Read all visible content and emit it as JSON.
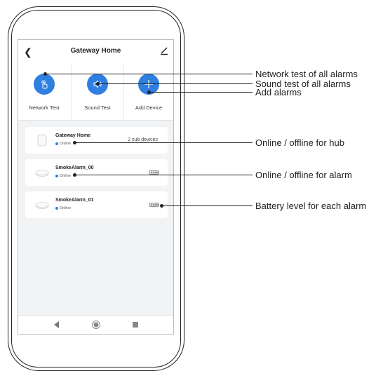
{
  "screen": {
    "title": "Gateway Home",
    "actions": [
      {
        "label": "Network Test",
        "icon": "hand-tap-icon"
      },
      {
        "label": "Sound Test",
        "icon": "speaker-icon"
      },
      {
        "label": "Add Device",
        "icon": "plus-icon"
      }
    ],
    "devices": [
      {
        "name": "Gateway Home",
        "status": "Online",
        "detail": "2 sub devices",
        "icon": "hub-icon"
      },
      {
        "name": "SmokeAlarm_00",
        "status": "Online",
        "icon": "smoke-alarm-icon"
      },
      {
        "name": "SmokeAlarm_01",
        "status": "Online",
        "icon": "smoke-alarm-icon"
      }
    ]
  },
  "callouts": [
    "Network test of all alarms",
    "Sound test of all alarms",
    "Add alarms",
    "Online / offline for hub",
    "Online / offline for alarm",
    "Battery level for each alarm"
  ],
  "colors": {
    "accent": "#2f7fe0",
    "status_dot": "#2f7fe0",
    "background": "#f2f3f5"
  }
}
